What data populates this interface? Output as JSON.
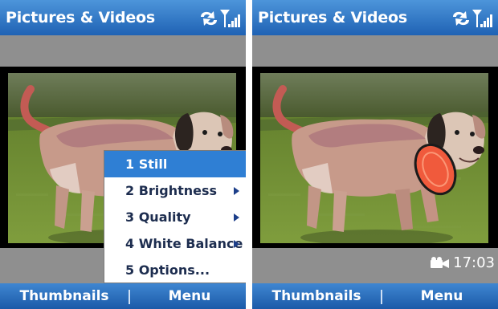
{
  "screens": [
    {
      "title": "Pictures & Videos",
      "softkeys": {
        "left": "Thumbnails",
        "right": "Menu"
      },
      "menu": {
        "items": [
          {
            "label": "1 Still",
            "selected": true,
            "has_submenu": false
          },
          {
            "label": "2 Brightness",
            "selected": false,
            "has_submenu": true
          },
          {
            "label": "3 Quality",
            "selected": false,
            "has_submenu": true
          },
          {
            "label": "4 White Balance",
            "selected": false,
            "has_submenu": true
          },
          {
            "label": "5 Options...",
            "selected": false,
            "has_submenu": false
          }
        ]
      }
    },
    {
      "title": "Pictures & Videos",
      "softkeys": {
        "left": "Thumbnails",
        "right": "Menu"
      },
      "camera_status": {
        "icon": "video-camera-icon",
        "time": "17:03"
      }
    }
  ],
  "icons": [
    "sync-icon",
    "signal-strength-icon",
    "submenu-arrow-icon",
    "video-camera-icon"
  ],
  "colors": {
    "title_bar": "#2f73c7",
    "softkey_bar": "#2a6fc2",
    "menu_highlight": "#2f7fd4",
    "menu_text": "#1d2d4f",
    "background": "#8f8f8f"
  }
}
